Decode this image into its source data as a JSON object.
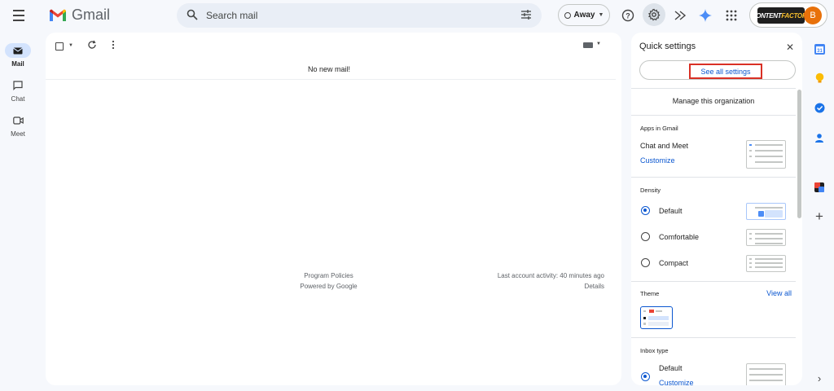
{
  "app": {
    "name": "Gmail"
  },
  "search": {
    "placeholder": "Search mail"
  },
  "status": {
    "label": "Away"
  },
  "account": {
    "brand_part1": "CONTENT",
    "brand_part2": "FACTORY",
    "avatar_letter": "B"
  },
  "rail": {
    "items": [
      {
        "label": "Mail"
      },
      {
        "label": "Chat"
      },
      {
        "label": "Meet"
      }
    ]
  },
  "main": {
    "empty_message": "No new mail!",
    "footer": {
      "program_policies": "Program Policies",
      "powered_by": "Powered by Google",
      "last_activity": "Last account activity: 40 minutes ago",
      "details": "Details"
    }
  },
  "quick_settings": {
    "title": "Quick settings",
    "see_all": "See all settings",
    "manage_org": "Manage this organization",
    "apps_heading": "Apps in Gmail",
    "chat_meet": "Chat and Meet",
    "customize": "Customize",
    "density_heading": "Density",
    "density_options": [
      {
        "label": "Default",
        "checked": true
      },
      {
        "label": "Comfortable",
        "checked": false
      },
      {
        "label": "Compact",
        "checked": false
      }
    ],
    "theme_heading": "Theme",
    "view_all": "View all",
    "inbox_heading": "Inbox type",
    "inbox_default": "Default",
    "inbox_customize": "Customize"
  },
  "colors": {
    "accent": "#0b57d0",
    "highlight_border": "#d93025",
    "background": "#f6f8fc"
  },
  "side_panel": {
    "calendar_day": "31"
  }
}
